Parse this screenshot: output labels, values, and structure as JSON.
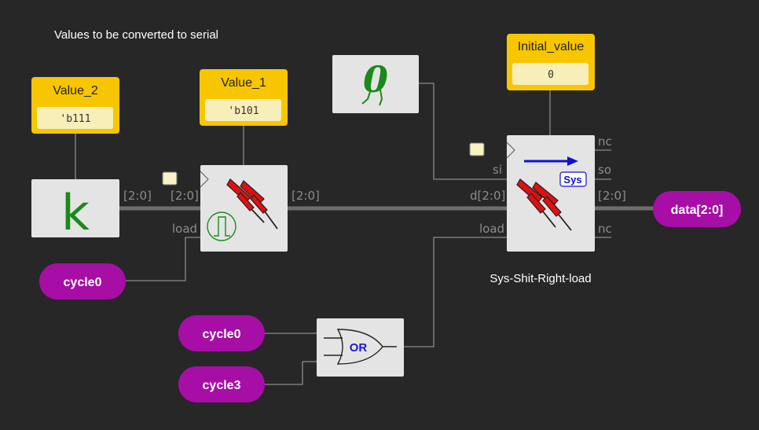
{
  "diagram": {
    "heading": "Values to be converted to serial",
    "constants": [
      {
        "id": "value2",
        "title": "Value_2",
        "value": "'b111"
      },
      {
        "id": "value1",
        "title": "Value_1",
        "value": "'b101"
      },
      {
        "id": "initial",
        "title": "Initial_value",
        "value": "0"
      }
    ],
    "inputs": [
      {
        "id": "cycle0_a",
        "label": "cycle0"
      },
      {
        "id": "cycle0_b",
        "label": "cycle0"
      },
      {
        "id": "cycle3",
        "label": "cycle3"
      }
    ],
    "outputs": [
      {
        "id": "data",
        "label": "data[2:0]"
      }
    ],
    "blocks": {
      "k": {
        "symbol": "k",
        "icon": "k-constant-icon"
      },
      "zero": {
        "symbol": "0",
        "icon": "zero-walking-icon"
      },
      "register": {
        "icon": "pushpin-icon",
        "sub_icon": "pulse-icon"
      },
      "or_gate": {
        "label": "OR",
        "icon": "or-gate-icon"
      },
      "shifter": {
        "caption": "Sys-Shit-Right-load",
        "badge": "Sys",
        "icon": "pushpin-icon",
        "arrow_icon": "right-arrow-icon"
      }
    },
    "port_labels": {
      "k_out": "[2:0]",
      "reg_in": "[2:0]",
      "reg_load": "load",
      "reg_out": "[2:0]",
      "sh_si": "si",
      "sh_d": "d[2:0]",
      "sh_load": "load",
      "sh_nc1": "nc",
      "sh_so": "so",
      "sh_out": "[2:0]",
      "sh_nc2": "nc"
    },
    "colors": {
      "background": "#272727",
      "constant_box": "#f7c600",
      "pill": "#a60ea6",
      "k_symbol": "#1a8a1a",
      "zero_symbol": "#1a8a1a",
      "pin": "#e01010",
      "arrow": "#1010d0",
      "or_label": "#1a1ad0"
    }
  }
}
